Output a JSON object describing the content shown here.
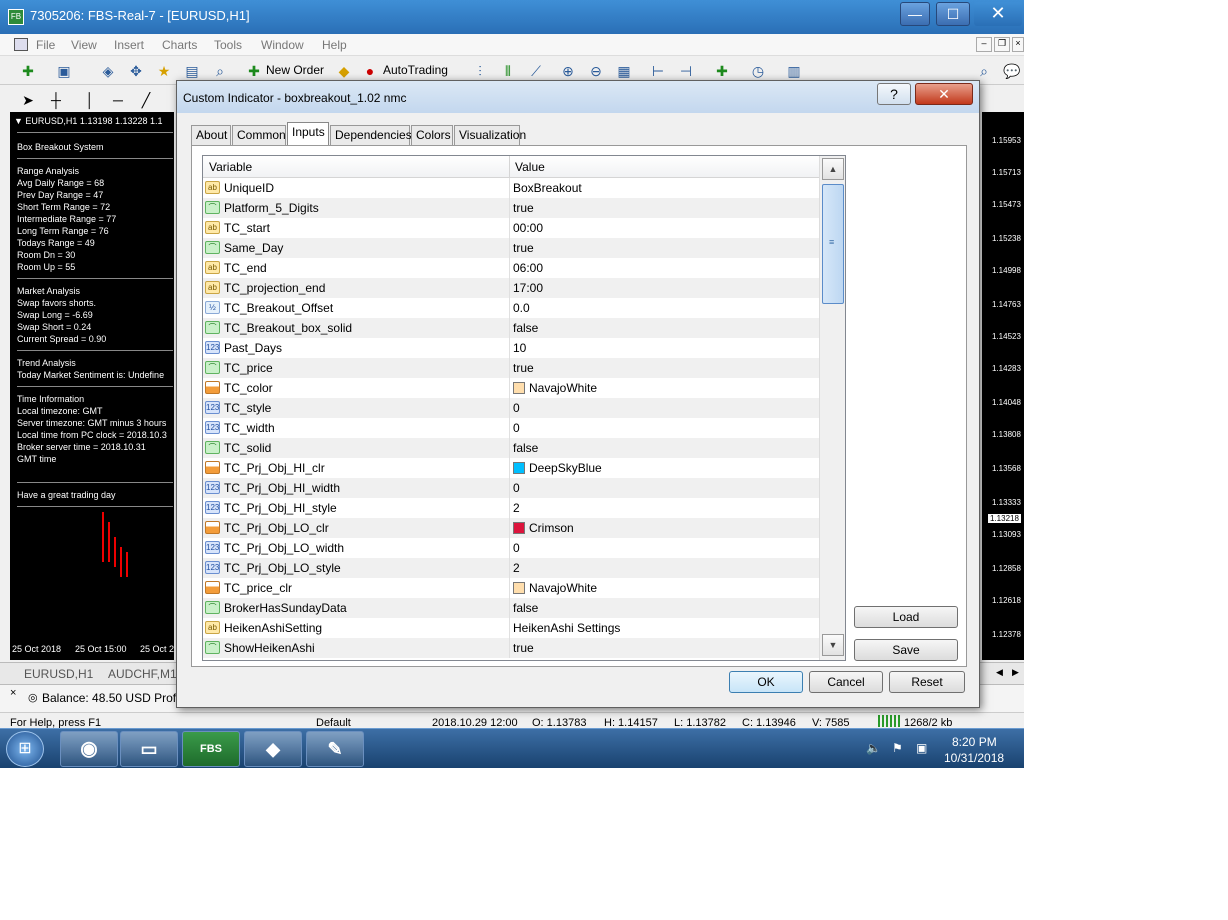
{
  "window": {
    "title": "7305206: FBS-Real-7 - [EURUSD,H1]",
    "minimize": "—",
    "maximize": "☐",
    "close": "✕"
  },
  "menu": [
    "File",
    "View",
    "Insert",
    "Charts",
    "Tools",
    "Window",
    "Help"
  ],
  "toolbar": {
    "new_order": "New Order",
    "autotrading": "AutoTrading"
  },
  "left_chart": {
    "header": "EURUSD,H1  1.13198 1.13228 1.1",
    "title": "Box Breakout System",
    "range_lines": [
      "Range Analysis",
      "Avg Daily Range = 68",
      "Prev Day Range = 47",
      "Short Term Range = 72",
      "Intermediate Range = 77",
      "Long Term Range = 76",
      "Todays Range = 49",
      "Room Dn = 30",
      "Room Up = 55"
    ],
    "market_lines": [
      "Market Analysis",
      "Swap favors shorts.",
      "Swap Long      = -6.69",
      "Swap Short     = 0.24",
      "Current Spread = 0.90"
    ],
    "trend_lines": [
      "Trend Analysis",
      "Today Market Sentiment is: Undefine"
    ],
    "time_lines": [
      "Time Information",
      "Local timezone: GMT",
      "Server timezone: GMT minus 3 hours",
      "Local time from PC clock = 2018.10.3",
      "Broker server time       = 2018.10.31",
      "GMT time"
    ],
    "footer": "Have a great trading day",
    "dates": [
      "25 Oct 2018",
      "25 Oct 15:00",
      "25 Oct 2"
    ]
  },
  "right_chart": {
    "prices": [
      "1.15953",
      "1.15713",
      "1.15473",
      "1.15238",
      "1.14998",
      "1.14763",
      "1.14523",
      "1.14283",
      "1.14048",
      "1.13808",
      "1.13568",
      "1.13333",
      "1.13218",
      "1.13093",
      "1.12858",
      "1.12618",
      "1.12378"
    ]
  },
  "chart_tabs": [
    "EURUSD,H1",
    "AUDCHF,M1"
  ],
  "terminal": {
    "balance": "Balance: 48.50 USD  Profi"
  },
  "statusbar": {
    "help": "For Help, press F1",
    "profile": "Default",
    "datetime": "2018.10.29 12:00",
    "open": "O: 1.13783",
    "high": "H: 1.14157",
    "low": "L: 1.13782",
    "close": "C: 1.13946",
    "volume": "V: 7585",
    "traffic": "1268/2 kb"
  },
  "taskbar": {
    "apps": [
      "FBS"
    ],
    "time": "8:20 PM",
    "date": "10/31/2018"
  },
  "dialog": {
    "title": "Custom Indicator - boxbreakout_1.02 nmc",
    "help_btn": "?",
    "close_btn": "✕",
    "tabs": [
      "About",
      "Common",
      "Inputs",
      "Dependencies",
      "Colors",
      "Visualization"
    ],
    "active_tab": "Inputs",
    "col_variable": "Variable",
    "col_value": "Value",
    "rows": [
      {
        "type": "ab",
        "icon": "ab",
        "name": "UniqueID",
        "value": "BoxBreakout"
      },
      {
        "type": "bool",
        "icon": "⌒",
        "name": "Platform_5_Digits",
        "value": "true"
      },
      {
        "type": "ab",
        "icon": "ab",
        "name": "TC_start",
        "value": "00:00"
      },
      {
        "type": "bool",
        "icon": "⌒",
        "name": "Same_Day",
        "value": "true"
      },
      {
        "type": "ab",
        "icon": "ab",
        "name": "TC_end",
        "value": "06:00"
      },
      {
        "type": "ab",
        "icon": "ab",
        "name": "TC_projection_end",
        "value": "17:00"
      },
      {
        "type": "dbl",
        "icon": "½",
        "name": "TC_Breakout_Offset",
        "value": "0.0"
      },
      {
        "type": "bool",
        "icon": "⌒",
        "name": "TC_Breakout_box_solid",
        "value": "false"
      },
      {
        "type": "num",
        "icon": "123",
        "name": "Past_Days",
        "value": "10"
      },
      {
        "type": "bool",
        "icon": "⌒",
        "name": "TC_price",
        "value": "true"
      },
      {
        "type": "clr",
        "icon": "",
        "name": "TC_color",
        "value": "NavajoWhite",
        "swatch": "#ffdead"
      },
      {
        "type": "num",
        "icon": "123",
        "name": "TC_style",
        "value": "0"
      },
      {
        "type": "num",
        "icon": "123",
        "name": "TC_width",
        "value": "0"
      },
      {
        "type": "bool",
        "icon": "⌒",
        "name": "TC_solid",
        "value": "false"
      },
      {
        "type": "clr",
        "icon": "",
        "name": "TC_Prj_Obj_HI_clr",
        "value": "DeepSkyBlue",
        "swatch": "#00bfff"
      },
      {
        "type": "num",
        "icon": "123",
        "name": "TC_Prj_Obj_HI_width",
        "value": "0"
      },
      {
        "type": "num",
        "icon": "123",
        "name": "TC_Prj_Obj_HI_style",
        "value": "2"
      },
      {
        "type": "clr",
        "icon": "",
        "name": "TC_Prj_Obj_LO_clr",
        "value": "Crimson",
        "swatch": "#dc143c"
      },
      {
        "type": "num",
        "icon": "123",
        "name": "TC_Prj_Obj_LO_width",
        "value": "0"
      },
      {
        "type": "num",
        "icon": "123",
        "name": "TC_Prj_Obj_LO_style",
        "value": "2"
      },
      {
        "type": "clr",
        "icon": "",
        "name": "TC_price_clr",
        "value": "NavajoWhite",
        "swatch": "#ffdead"
      },
      {
        "type": "bool",
        "icon": "⌒",
        "name": "BrokerHasSundayData",
        "value": "false"
      },
      {
        "type": "ab",
        "icon": "ab",
        "name": "HeikenAshiSetting",
        "value": "HeikenAshi Settings"
      },
      {
        "type": "bool",
        "icon": "⌒",
        "name": "ShowHeikenAshi",
        "value": "true"
      }
    ],
    "load_btn": "Load",
    "save_btn": "Save",
    "ok_btn": "OK",
    "cancel_btn": "Cancel",
    "reset_btn": "Reset"
  }
}
